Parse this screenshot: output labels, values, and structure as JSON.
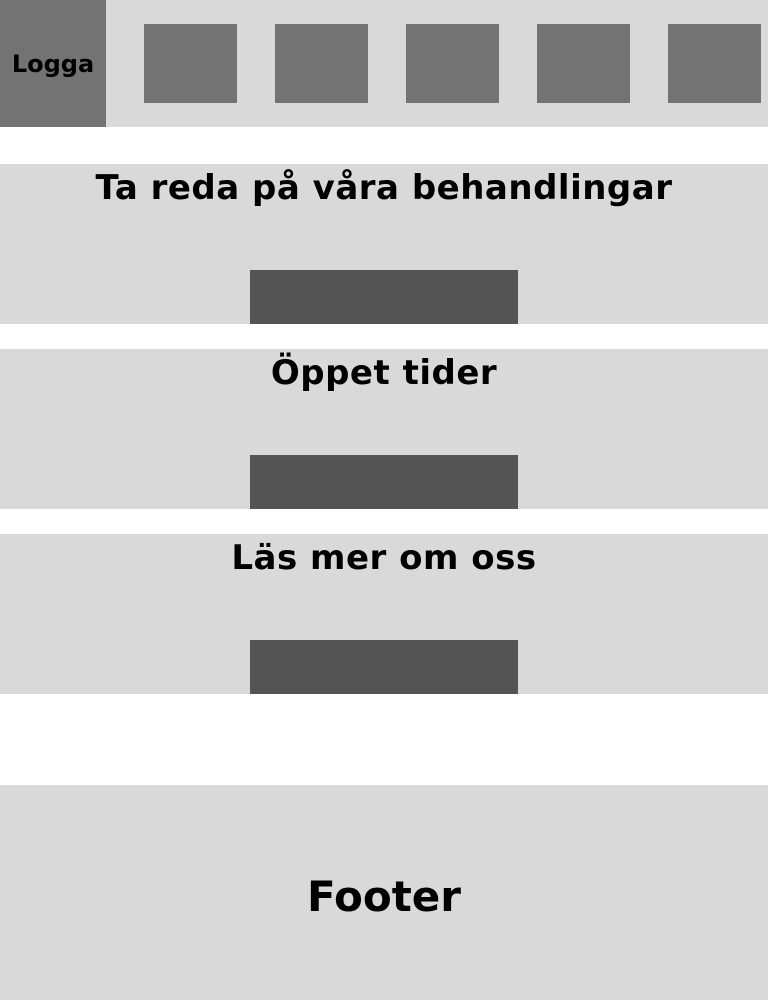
{
  "header": {
    "logo_label": "Logga",
    "nav_count": 5
  },
  "sections": [
    {
      "title": "Ta reda på våra behandlingar"
    },
    {
      "title": "Öppet tider"
    },
    {
      "title": "Läs mer om oss"
    }
  ],
  "footer": {
    "label": "Footer"
  },
  "colors": {
    "background": "#ffffff",
    "panel": "#d9d9d9",
    "nav_placeholder": "#737373",
    "button": "#545454",
    "text": "#000000"
  }
}
